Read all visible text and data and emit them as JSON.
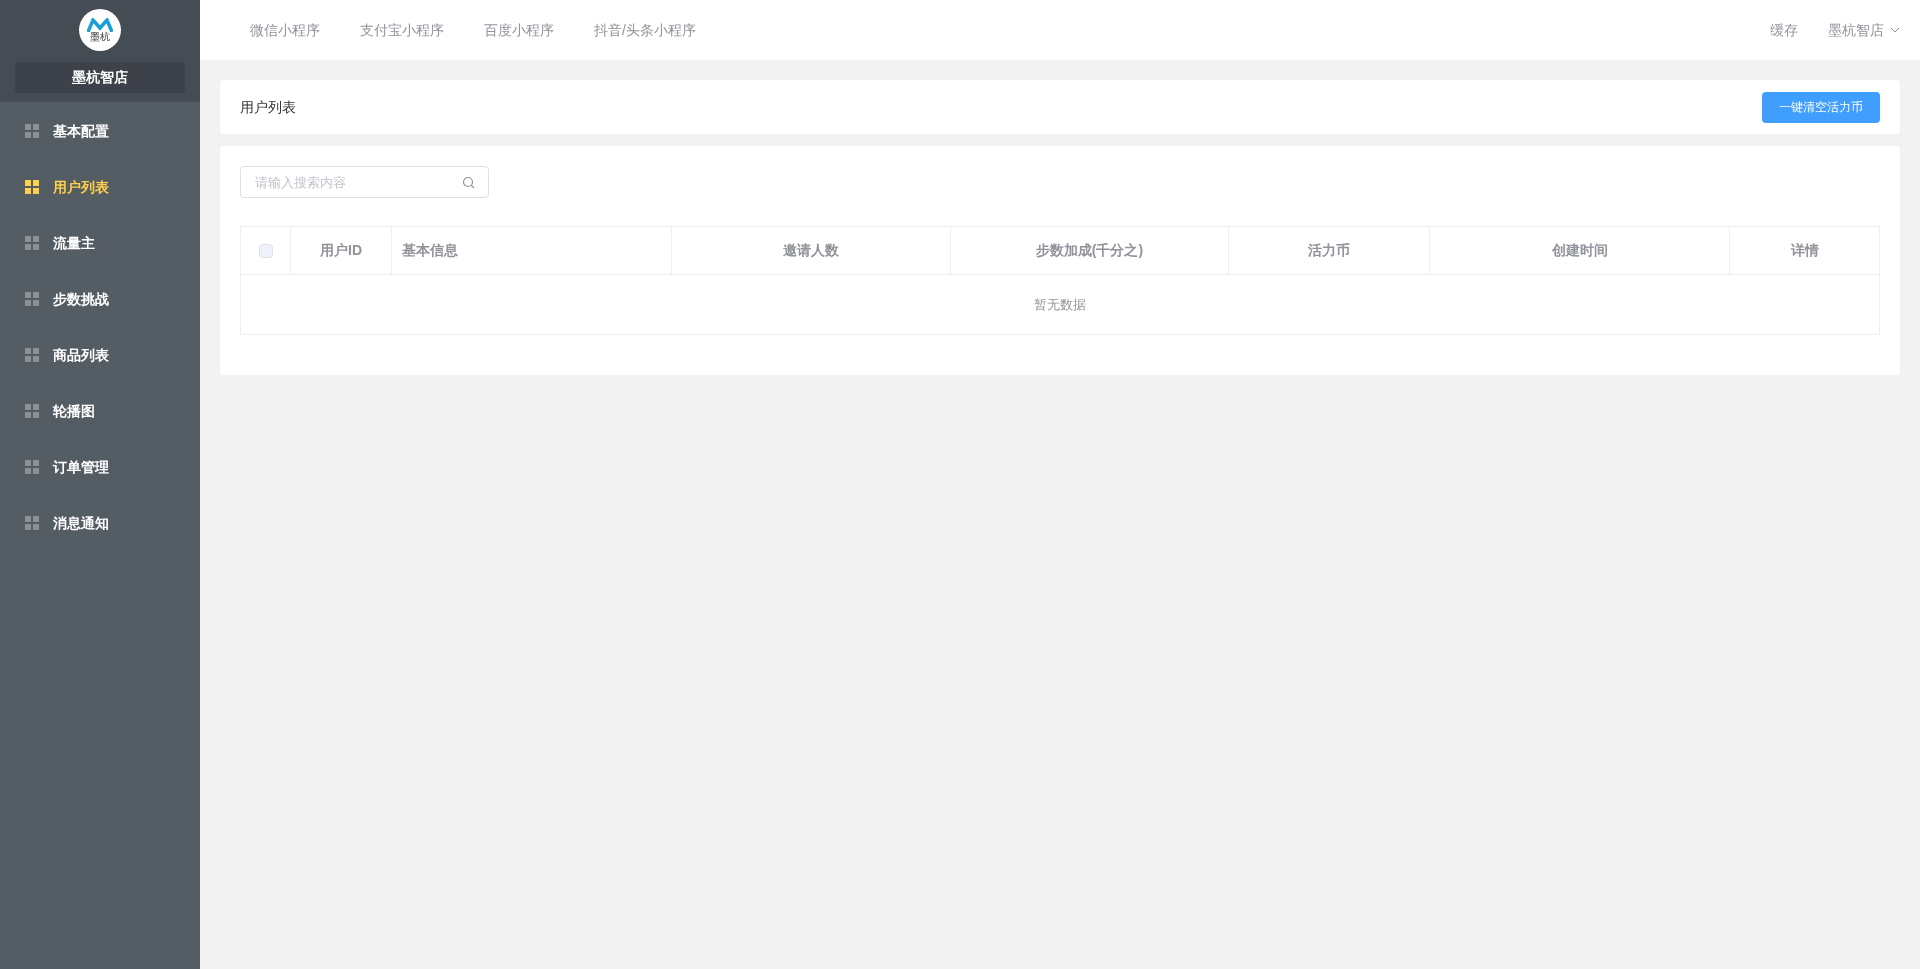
{
  "sidebar": {
    "logo_text": "墨杭",
    "store_name": "墨杭智店",
    "items": [
      {
        "label": "基本配置",
        "selected": false
      },
      {
        "label": "用户列表",
        "selected": true
      },
      {
        "label": "流量主",
        "selected": false
      },
      {
        "label": "步数挑战",
        "selected": false
      },
      {
        "label": "商品列表",
        "selected": false
      },
      {
        "label": "轮播图",
        "selected": false
      },
      {
        "label": "订单管理",
        "selected": false
      },
      {
        "label": "消息通知",
        "selected": false
      }
    ]
  },
  "top_nav": {
    "tabs": [
      "微信小程序",
      "支付宝小程序",
      "百度小程序",
      "抖音/头条小程序"
    ],
    "cache": "缓存",
    "user": "墨杭智店"
  },
  "header": {
    "title": "用户列表",
    "button": "一键清空活力币"
  },
  "search": {
    "placeholder": "请输入搜索内容"
  },
  "table": {
    "select_all_checked": false,
    "columns": [
      "用户ID",
      "基本信息",
      "邀请人数",
      "步数加成(千分之)",
      "活力币",
      "创建时间",
      "详情"
    ],
    "empty_text": "暂无数据"
  }
}
